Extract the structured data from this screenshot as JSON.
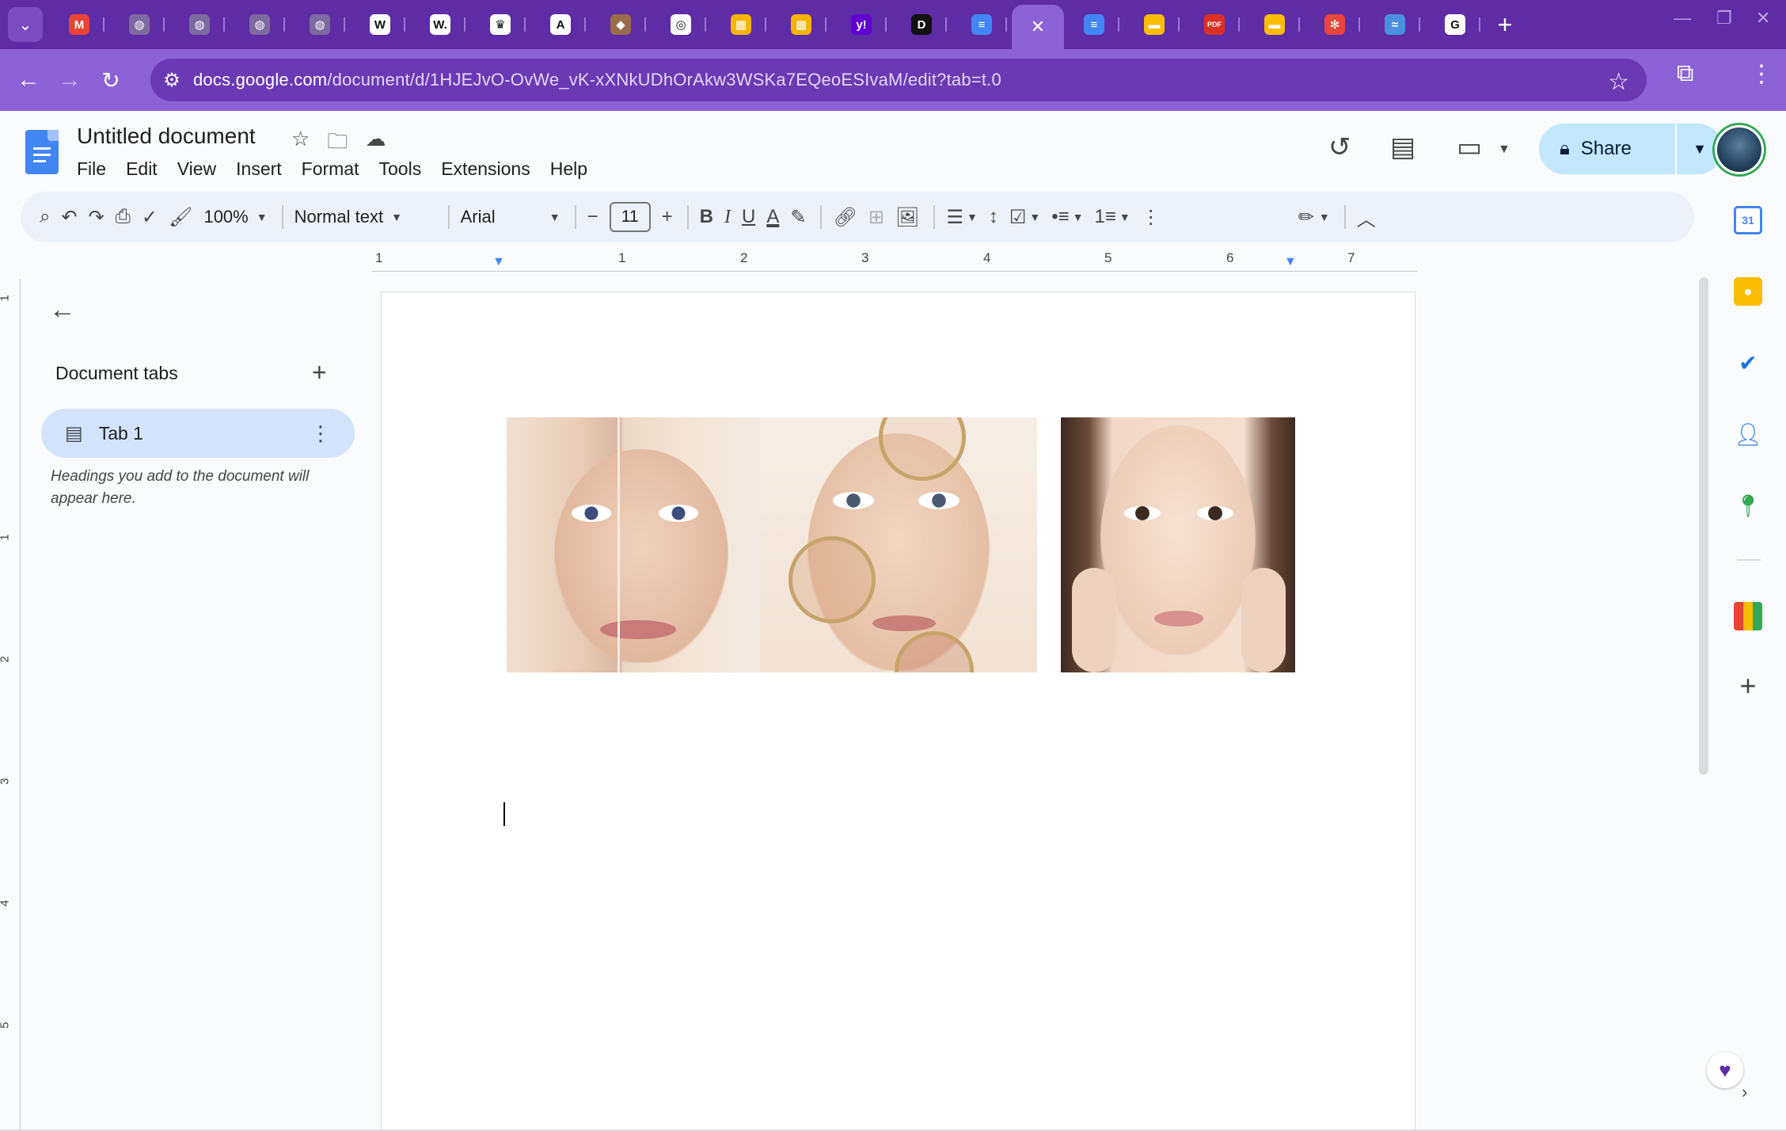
{
  "browser": {
    "tabs": [
      {
        "icon": "gmail-icon",
        "color": "#ea4335",
        "glyph": "M"
      },
      {
        "icon": "globe-icon",
        "color": "#7d6aa0",
        "glyph": "◍"
      },
      {
        "icon": "globe-icon",
        "color": "#7d6aa0",
        "glyph": "◍"
      },
      {
        "icon": "globe-icon",
        "color": "#7d6aa0",
        "glyph": "◍"
      },
      {
        "icon": "globe-icon",
        "color": "#7d6aa0",
        "glyph": "◍"
      },
      {
        "icon": "wikipedia-icon",
        "color": "#ffffff",
        "glyph": "W"
      },
      {
        "icon": "wikipedia-icon",
        "color": "#ffffff",
        "glyph": "W."
      },
      {
        "icon": "crown-icon",
        "color": "#ffffff",
        "glyph": "♛"
      },
      {
        "icon": "letter-a-icon",
        "color": "#ffffff",
        "glyph": "A"
      },
      {
        "icon": "app-icon",
        "color": "#9c6b4a",
        "glyph": "◆"
      },
      {
        "icon": "chrome-icon",
        "color": "#ffffff",
        "glyph": "◎"
      },
      {
        "icon": "colorful-app-icon",
        "color": "#f4b400",
        "glyph": "▦"
      },
      {
        "icon": "colorful-app-icon",
        "color": "#f4b400",
        "glyph": "▦"
      },
      {
        "icon": "yahoo-icon",
        "color": "#6001d2",
        "glyph": "y!"
      },
      {
        "icon": "video-app-icon",
        "color": "#111111",
        "glyph": "D"
      },
      {
        "icon": "google-docs-icon",
        "color": "#4285f4",
        "glyph": "≡"
      },
      {
        "icon": "google-docs-icon",
        "color": "#4285f4",
        "glyph": "≡"
      },
      {
        "icon": "google-docs-icon",
        "color": "#4285f4",
        "glyph": "≡"
      },
      {
        "icon": "google-slides-icon",
        "color": "#fbbc04",
        "glyph": "▬"
      },
      {
        "icon": "pdf-icon",
        "color": "#d93025",
        "glyph": "PDF"
      },
      {
        "icon": "google-slides-icon",
        "color": "#fbbc04",
        "glyph": "▬"
      },
      {
        "icon": "asterisk-app-icon",
        "color": "#e8453c",
        "glyph": "✻"
      },
      {
        "icon": "signature-icon",
        "color": "#4a90e2",
        "glyph": "≈"
      },
      {
        "icon": "google-icon",
        "color": "#ffffff",
        "glyph": "G"
      }
    ],
    "active_tab_index": 16,
    "url_host": "docs.google.com",
    "url_path": "/document/d/1HJEJvO-OvWe_vK-xXNkUDhOrAkw3WSKa7EQeoESIvaM/edit?tab=t.0"
  },
  "docs": {
    "title": "Untitled document",
    "menu": [
      "File",
      "Edit",
      "View",
      "Insert",
      "Format",
      "Tools",
      "Extensions",
      "Help"
    ],
    "share_label": "Share",
    "toolbar": {
      "zoom": "100%",
      "style": "Normal text",
      "font": "Arial",
      "font_size": "11"
    },
    "ruler_labels": [
      "1",
      "1",
      "2",
      "3",
      "4",
      "5",
      "6",
      "7"
    ],
    "vruler_labels": [
      "1",
      "1",
      "2",
      "3",
      "4",
      "5"
    ],
    "outline": {
      "title": "Document tabs",
      "tab_label": "Tab 1",
      "hint": "Headings you add to the document will appear here."
    },
    "colors": {
      "brand_blue": "#4285f4",
      "share_bg": "#c2e7ff",
      "selected_tab_bg": "#d3e3fd",
      "browser_frame": "#5e2ca5"
    }
  }
}
